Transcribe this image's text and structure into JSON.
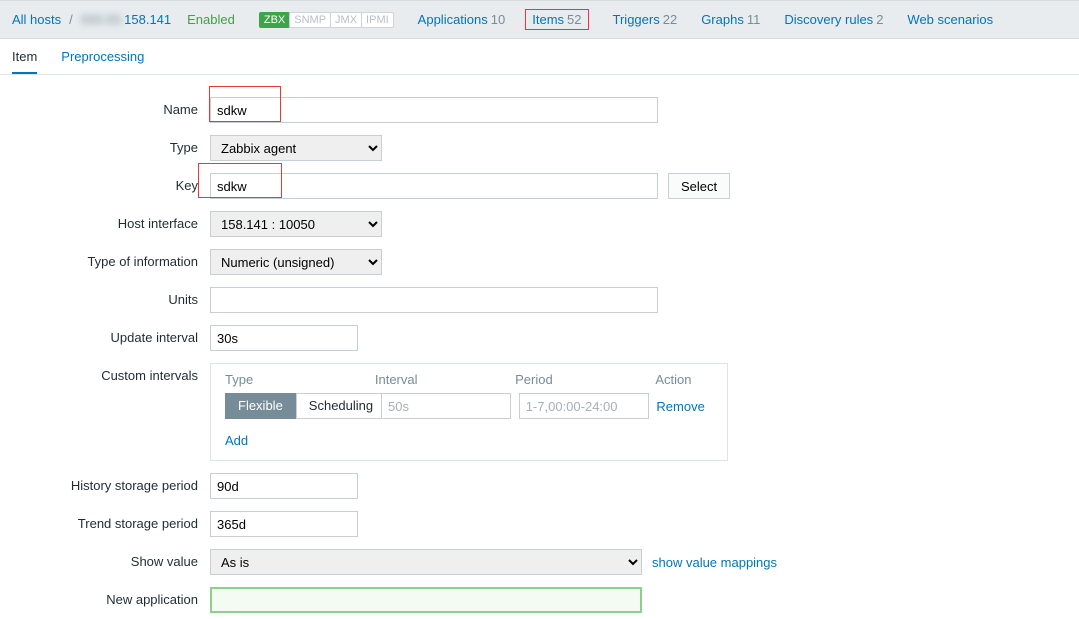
{
  "breadcrumb": {
    "all_hosts": "All hosts",
    "host_suffix": "158.141",
    "enabled": "Enabled"
  },
  "tags": {
    "zbx": "ZBX",
    "snmp": "SNMP",
    "jmx": "JMX",
    "ipmi": "IPMI"
  },
  "nav": {
    "applications": {
      "label": "Applications",
      "count": "10"
    },
    "items": {
      "label": "Items",
      "count": "52"
    },
    "triggers": {
      "label": "Triggers",
      "count": "22"
    },
    "graphs": {
      "label": "Graphs",
      "count": "11"
    },
    "discovery": {
      "label": "Discovery rules",
      "count": "2"
    },
    "web": {
      "label": "Web scenarios",
      "count": ""
    }
  },
  "tabs": {
    "item": "Item",
    "preprocessing": "Preprocessing"
  },
  "labels": {
    "name": "Name",
    "type": "Type",
    "key": "Key",
    "host_interface": "Host interface",
    "type_of_information": "Type of information",
    "units": "Units",
    "update_interval": "Update interval",
    "custom_intervals": "Custom intervals",
    "history_storage": "History storage period",
    "trend_storage": "Trend storage period",
    "show_value": "Show value",
    "new_application": "New application"
  },
  "values": {
    "name": "sdkw",
    "type": "Zabbix agent",
    "key": "sdkw",
    "host_interface": "158.141 : 10050",
    "type_of_information": "Numeric (unsigned)",
    "units": "",
    "update_interval": "30s",
    "history_storage": "90d",
    "trend_storage": "365d",
    "show_value": "As is"
  },
  "buttons": {
    "select": "Select",
    "add": "Add",
    "remove": "Remove",
    "show_value_mappings": "show value mappings"
  },
  "custom_intervals": {
    "head_type": "Type",
    "head_interval": "Interval",
    "head_period": "Period",
    "head_action": "Action",
    "flexible": "Flexible",
    "scheduling": "Scheduling",
    "interval_placeholder": "50s",
    "period_placeholder": "1-7,00:00-24:00"
  }
}
